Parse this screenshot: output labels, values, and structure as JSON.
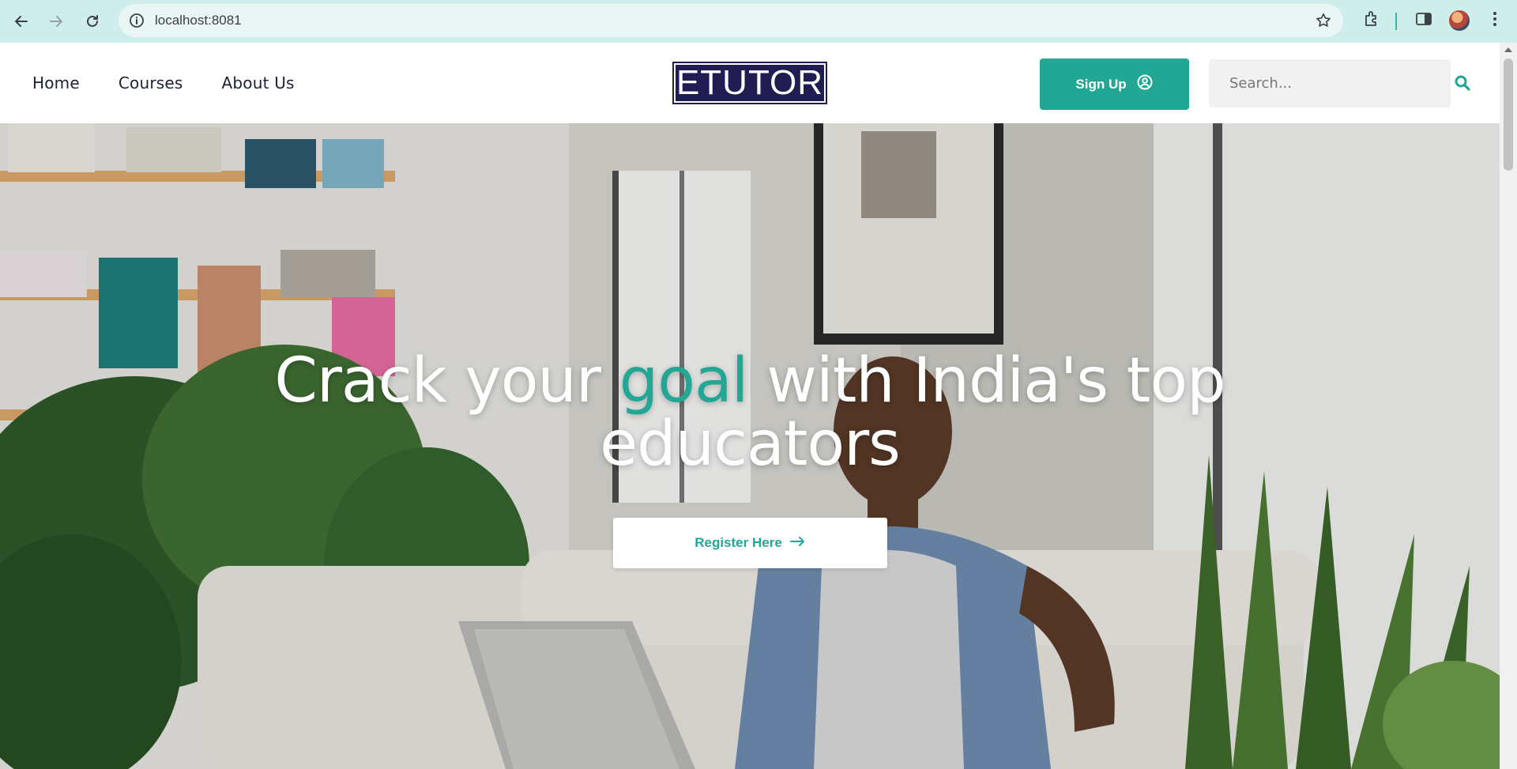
{
  "browser": {
    "url": "localhost:8081",
    "icons": [
      "back-arrow-icon",
      "forward-arrow-icon",
      "reload-icon",
      "site-info-icon",
      "bookmark-star-icon",
      "extensions-icon",
      "side-panel-icon",
      "profile-avatar",
      "more-menu-icon"
    ]
  },
  "header": {
    "nav": [
      {
        "label": "Home"
      },
      {
        "label": "Courses"
      },
      {
        "label": "About Us"
      }
    ],
    "logo_text": "ETUTOR",
    "signup_label": "Sign Up",
    "search_placeholder": "Search...",
    "colors": {
      "brand": "#22a795",
      "logo_bg": "#1f1d52"
    }
  },
  "hero": {
    "title_before": "Crack your",
    "title_accent": "goal",
    "title_line1_after": "with India's top",
    "title_line2": "educators",
    "cta_label": "Register Here"
  }
}
